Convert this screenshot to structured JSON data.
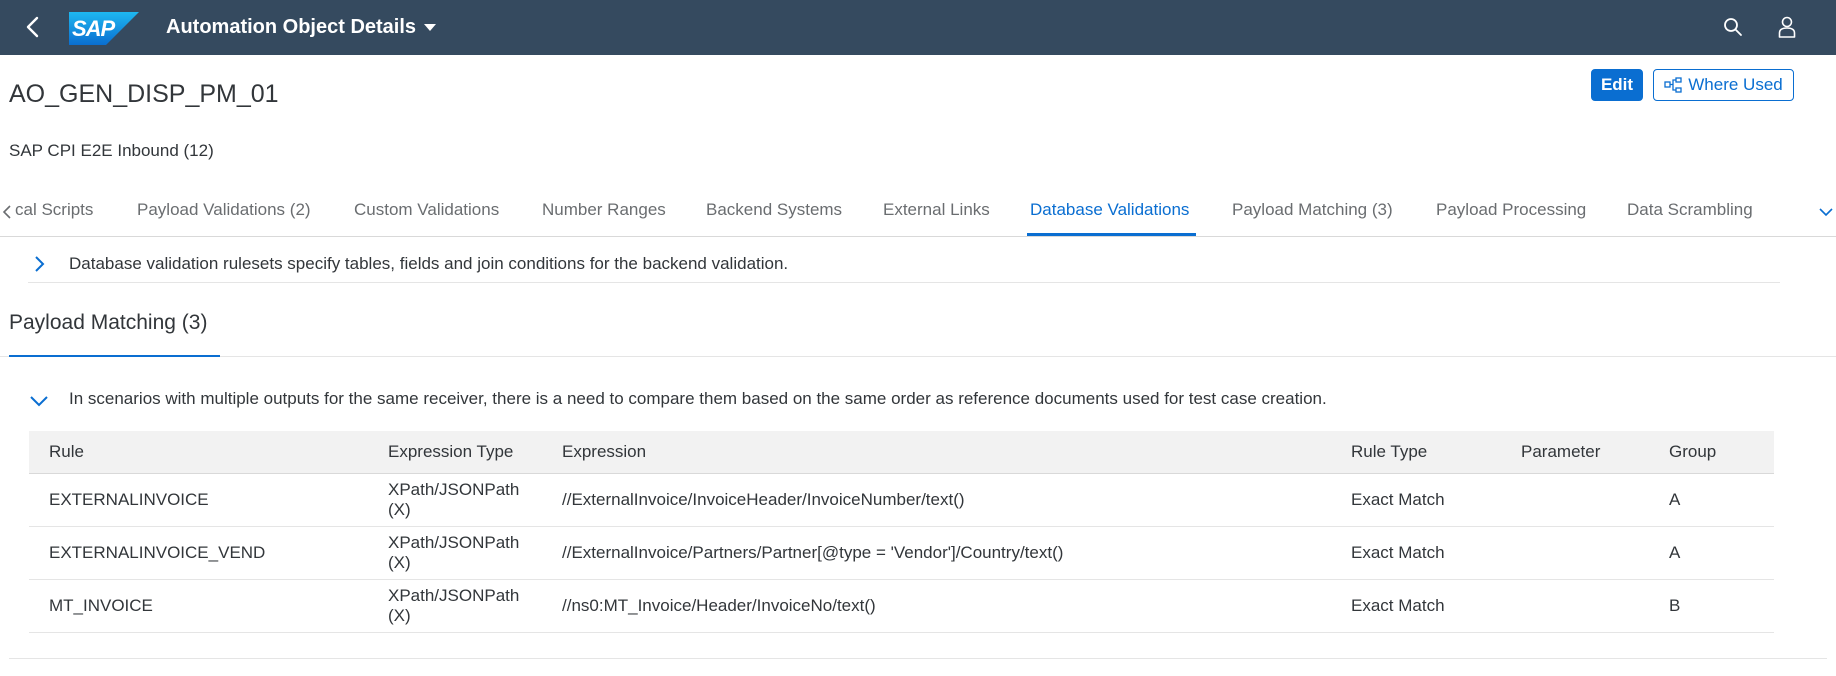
{
  "shell": {
    "logo_text": "SAP",
    "title": "Automation Object Details",
    "icons": {
      "back": "back-icon",
      "search": "search-icon",
      "user": "user-icon"
    },
    "bar_color": "#354a5f"
  },
  "header": {
    "title": "AO_GEN_DISP_PM_01",
    "subtitle": "SAP CPI E2E Inbound (12)",
    "edit_label": "Edit",
    "where_used_label": "Where Used",
    "accent": "#0a6ed1"
  },
  "tabs": [
    {
      "label": "cal Scripts"
    },
    {
      "label": "Payload Validations (2)"
    },
    {
      "label": "Custom Validations"
    },
    {
      "label": "Number Ranges"
    },
    {
      "label": "Backend Systems"
    },
    {
      "label": "External Links"
    },
    {
      "label": "Database Validations",
      "active": true
    },
    {
      "label": "Payload Matching (3)"
    },
    {
      "label": "Payload Processing"
    },
    {
      "label": "Data Scrambling"
    }
  ],
  "db_validations": {
    "description": "Database validation rulesets specify tables, fields and join conditions for the backend validation."
  },
  "payload_matching": {
    "title": "Payload Matching (3)",
    "description": "In scenarios with multiple outputs for the same receiver, there is a need to compare them based on the same order as reference documents used for test case creation.",
    "columns": [
      "Rule",
      "Expression Type",
      "Expression",
      "Rule Type",
      "Parameter",
      "Group"
    ],
    "rows": [
      {
        "rule": "EXTERNALINVOICE",
        "expr_type_1": "XPath/JSONPath",
        "expr_type_2": "(X)",
        "expression": "//ExternalInvoice/InvoiceHeader/InvoiceNumber/text()",
        "rule_type": "Exact Match",
        "parameter": "",
        "group": "A"
      },
      {
        "rule": "EXTERNALINVOICE_VEND",
        "expr_type_1": "XPath/JSONPath",
        "expr_type_2": "(X)",
        "expression": "//ExternalInvoice/Partners/Partner[@type = 'Vendor']/Country/text()",
        "rule_type": "Exact Match",
        "parameter": "",
        "group": "A"
      },
      {
        "rule": "MT_INVOICE",
        "expr_type_1": "XPath/JSONPath",
        "expr_type_2": "(X)",
        "expression": "//ns0:MT_Invoice/Header/InvoiceNo/text()",
        "rule_type": "Exact Match",
        "parameter": "",
        "group": "B"
      }
    ]
  }
}
